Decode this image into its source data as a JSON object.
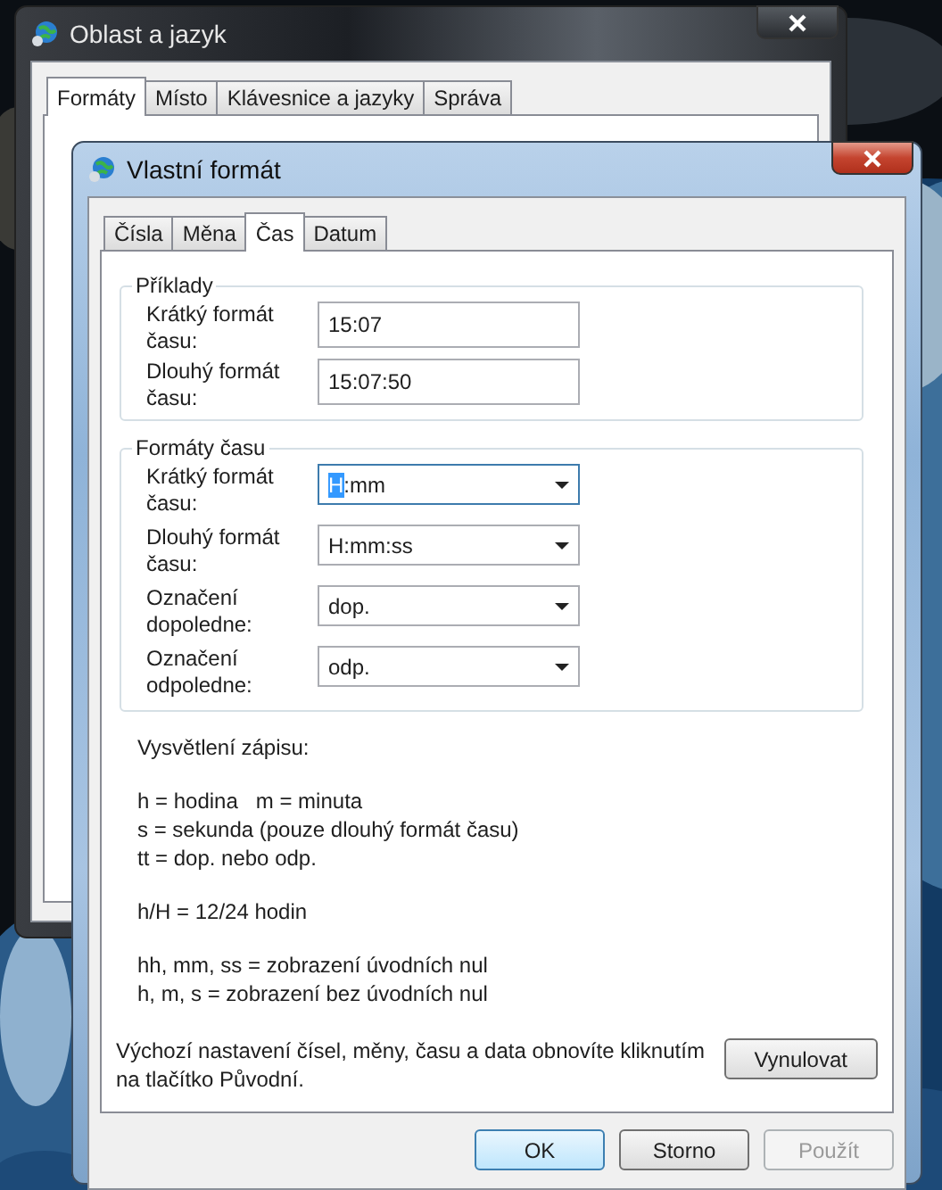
{
  "back_window": {
    "title": "Oblast a jazyk",
    "tabs": [
      {
        "label": "Formáty",
        "selected": true
      },
      {
        "label": "Místo",
        "selected": false
      },
      {
        "label": "Klávesnice a jazyky",
        "selected": false
      },
      {
        "label": "Správa",
        "selected": false
      }
    ]
  },
  "window": {
    "title": "Vlastní formát",
    "tabs": [
      {
        "label": "Čísla",
        "selected": false
      },
      {
        "label": "Měna",
        "selected": false
      },
      {
        "label": "Čas",
        "selected": true
      },
      {
        "label": "Datum",
        "selected": false
      }
    ],
    "examples": {
      "legend": "Příklady",
      "rows": [
        {
          "label": "Krátký formát času:",
          "value": "15:07"
        },
        {
          "label": "Dlouhý formát času:",
          "value": "15:07:50"
        }
      ]
    },
    "time_formats": {
      "legend": "Formáty času",
      "rows": [
        {
          "label": "Krátký formát času:",
          "value": "H:mm",
          "focused": true
        },
        {
          "label": "Dlouhý formát času:",
          "value": "H:mm:ss",
          "focused": false
        },
        {
          "label": "Označení dopoledne:",
          "value": "dop.",
          "focused": false
        },
        {
          "label": "Označení odpoledne:",
          "value": "odp.",
          "focused": false
        }
      ]
    },
    "notes_title": "Vysvětlení zápisu:",
    "notes": [
      [
        "h = hodina   m = minuta",
        "s = sekunda (pouze dlouhý formát času)",
        "tt = dop. nebo odp."
      ],
      [
        "h/H = 12/24 hodin"
      ],
      [
        "hh, mm, ss = zobrazení úvodních nul",
        "h, m, s = zobrazení bez úvodních nul"
      ]
    ],
    "reset_text": "Výchozí nastavení čísel, měny, času a data obnovíte kliknutím na tlačítko Původní.",
    "reset_button": "Vynulovat",
    "buttons": [
      {
        "label": "OK",
        "default": true,
        "disabled": false
      },
      {
        "label": "Storno",
        "default": false,
        "disabled": false
      },
      {
        "label": "Použít",
        "default": false,
        "disabled": true
      }
    ]
  }
}
